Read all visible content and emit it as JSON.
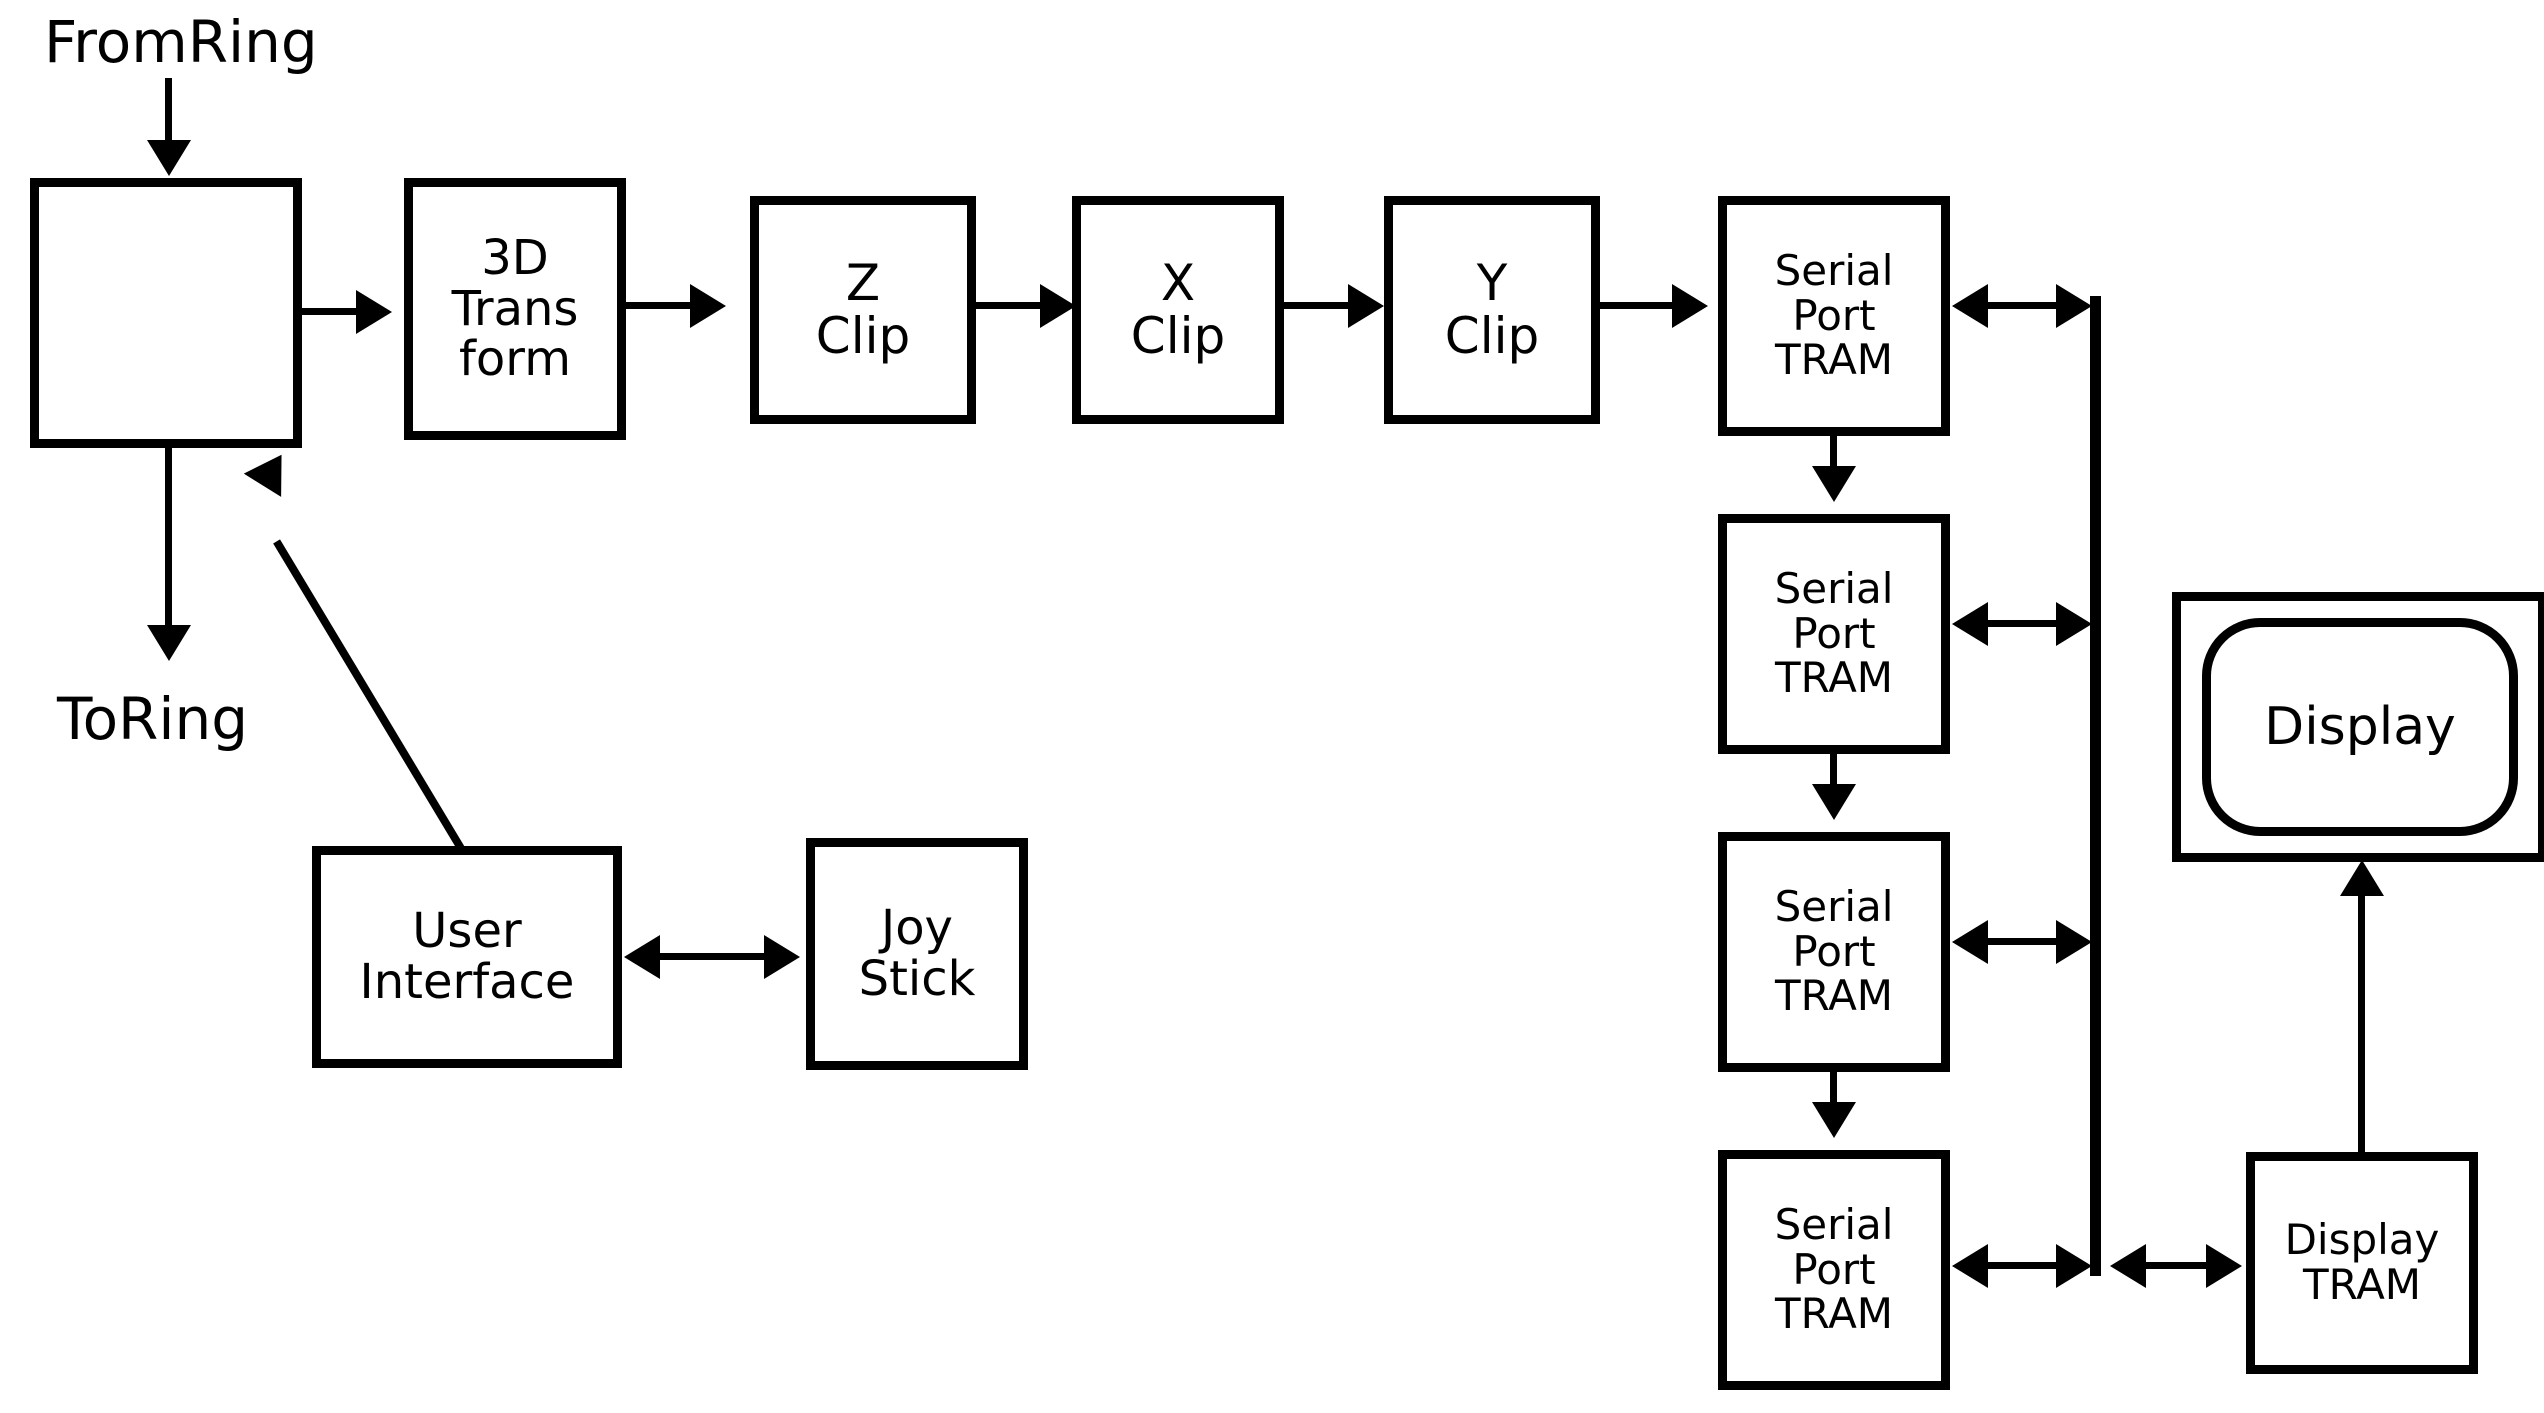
{
  "diagram": {
    "title": "Graphics pipeline block diagram",
    "ink_color": "#000000",
    "background_color": "#ffffff",
    "labels": {
      "from_ring": "FromRing",
      "to_ring": "ToRing"
    },
    "blocks": {
      "ring_node": {
        "label": "",
        "lines": []
      },
      "transform": {
        "lines": [
          "3D",
          "Trans",
          "form"
        ]
      },
      "z_clip": {
        "lines": [
          "Z",
          "Clip"
        ]
      },
      "x_clip": {
        "lines": [
          "X",
          "Clip"
        ]
      },
      "y_clip": {
        "lines": [
          "Y",
          "Clip"
        ]
      },
      "serial_port_tram_1": {
        "lines": [
          "Serial",
          "Port",
          "TRAM"
        ]
      },
      "serial_port_tram_2": {
        "lines": [
          "Serial",
          "Port",
          "TRAM"
        ]
      },
      "serial_port_tram_3": {
        "lines": [
          "Serial",
          "Port",
          "TRAM"
        ]
      },
      "serial_port_tram_4": {
        "lines": [
          "Serial",
          "Port",
          "TRAM"
        ]
      },
      "display": {
        "lines": [
          "Display"
        ]
      },
      "display_tram": {
        "lines": [
          "Display",
          "TRAM"
        ]
      },
      "user_interface": {
        "lines": [
          "User",
          "Interface"
        ]
      },
      "joy_stick": {
        "lines": [
          "Joy",
          "Stick"
        ]
      }
    },
    "connections": [
      {
        "from": "FromRing",
        "to": "ring_node",
        "type": "arrow-down"
      },
      {
        "from": "ring_node",
        "to": "ToRing",
        "type": "arrow-down"
      },
      {
        "from": "ring_node",
        "to": "transform",
        "type": "arrow-right"
      },
      {
        "from": "transform",
        "to": "z_clip",
        "type": "arrow-right"
      },
      {
        "from": "z_clip",
        "to": "x_clip",
        "type": "arrow-right"
      },
      {
        "from": "x_clip",
        "to": "y_clip",
        "type": "arrow-right"
      },
      {
        "from": "y_clip",
        "to": "serial_port_tram_1",
        "type": "arrow-right"
      },
      {
        "from": "serial_port_tram_1",
        "to": "serial_port_tram_2",
        "type": "arrow-down"
      },
      {
        "from": "serial_port_tram_2",
        "to": "serial_port_tram_3",
        "type": "arrow-down"
      },
      {
        "from": "serial_port_tram_3",
        "to": "serial_port_tram_4",
        "type": "arrow-down"
      },
      {
        "from": "serial_port_tram_1",
        "to": "bus",
        "type": "bidirectional"
      },
      {
        "from": "serial_port_tram_2",
        "to": "bus",
        "type": "bidirectional"
      },
      {
        "from": "serial_port_tram_3",
        "to": "bus",
        "type": "bidirectional"
      },
      {
        "from": "serial_port_tram_4",
        "to": "bus",
        "type": "bidirectional"
      },
      {
        "from": "bus",
        "to": "display_tram",
        "type": "bidirectional"
      },
      {
        "from": "display_tram",
        "to": "display",
        "type": "arrow-up"
      },
      {
        "from": "user_interface",
        "to": "joy_stick",
        "type": "bidirectional"
      },
      {
        "from": "user_interface",
        "to": "ring_node",
        "type": "arrow-up-diagonal"
      }
    ]
  }
}
